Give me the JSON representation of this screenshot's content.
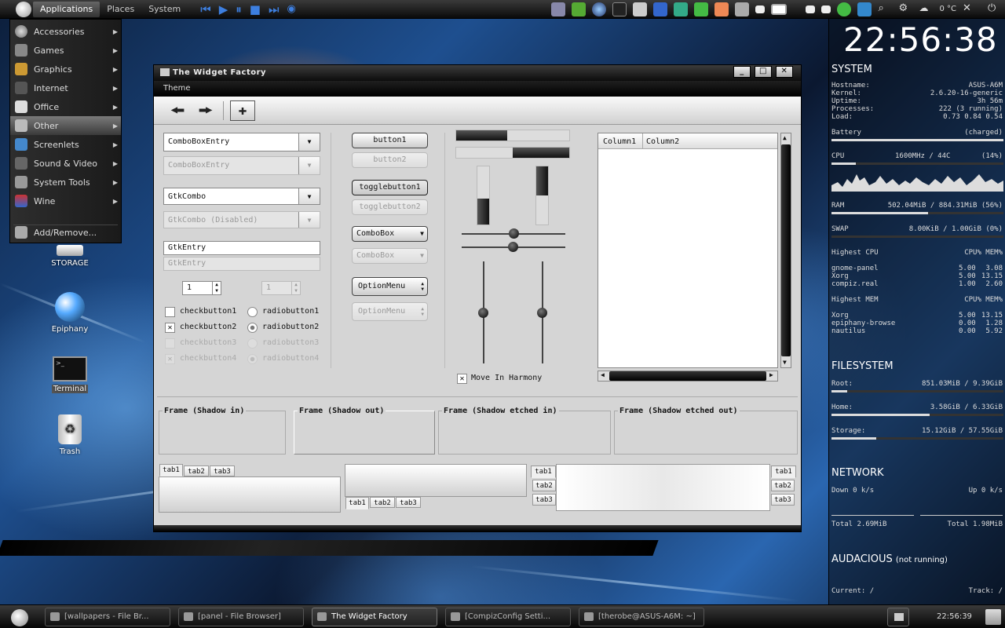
{
  "top_panel": {
    "menus": [
      "Applications",
      "Places",
      "System"
    ],
    "temperature": "0 °C"
  },
  "apps_menu": {
    "items": [
      {
        "label": "Accessories",
        "icon": "accessories-icon"
      },
      {
        "label": "Games",
        "icon": "games-icon"
      },
      {
        "label": "Graphics",
        "icon": "graphics-icon"
      },
      {
        "label": "Internet",
        "icon": "internet-icon"
      },
      {
        "label": "Office",
        "icon": "office-icon"
      },
      {
        "label": "Other",
        "icon": "other-icon"
      },
      {
        "label": "Screenlets",
        "icon": "screenlets-icon"
      },
      {
        "label": "Sound & Video",
        "icon": "sound-video-icon"
      },
      {
        "label": "System Tools",
        "icon": "system-tools-icon"
      },
      {
        "label": "Wine",
        "icon": "wine-icon"
      }
    ],
    "add_remove": "Add/Remove...",
    "selected": "Other"
  },
  "desktop_icons": [
    "STORAGE",
    "Epiphany",
    "Terminal",
    "Trash"
  ],
  "window": {
    "title": "The Widget Factory",
    "menubar": [
      "Theme"
    ],
    "combo_entry": "ComboBoxEntry",
    "combo_entry_disabled": "ComboBoxEntry",
    "gtk_combo": "GtkCombo",
    "gtk_combo_disabled": "GtkCombo (Disabled)",
    "entry": "GtkEntry",
    "entry_disabled": "GtkEntry",
    "spin1": "1",
    "spin2": "1",
    "checks": [
      "checkbutton1",
      "checkbutton2",
      "checkbutton3",
      "checkbutton4"
    ],
    "radios": [
      "radiobutton1",
      "radiobutton2",
      "radiobutton3",
      "radiobutton4"
    ],
    "buttons": [
      "button1",
      "button2"
    ],
    "toggles": [
      "togglebutton1",
      "togglebutton2"
    ],
    "combobox": "ComboBox",
    "combobox_disabled": "ComboBox",
    "optionmenu": "OptionMenu",
    "optionmenu_disabled": "OptionMenu",
    "move_in_harmony": "Move In Harmony",
    "columns": [
      "Column1",
      "Column2"
    ],
    "frames": [
      "Frame (Shadow in)",
      "Frame (Shadow out)",
      "Frame (Shadow etched in)",
      "Frame (Shadow etched out)"
    ],
    "tabs": [
      "tab1",
      "tab2",
      "tab3"
    ]
  },
  "taskbar": {
    "tasks": [
      "[wallpapers - File Br...",
      "[panel - File Browser]",
      "The Widget Factory",
      "[CompizConfig Setti...",
      "[therobe@ASUS-A6M: ~]"
    ],
    "clock": "22:56:39"
  },
  "conky": {
    "time": "22:56:38",
    "system_header": "SYSTEM",
    "system": [
      [
        "Hostname:",
        "ASUS-A6M"
      ],
      [
        "Kernel:",
        "2.6.20-16-generic"
      ],
      [
        "Uptime:",
        "3h 56m"
      ],
      [
        "Processes:",
        "222 (3 running)"
      ],
      [
        "Load:",
        "0.73 0.84 0.54"
      ]
    ],
    "battery": [
      "Battery",
      "(charged)"
    ],
    "cpu": [
      "CPU",
      "1600MHz / 44C",
      "(14%)"
    ],
    "ram": [
      "RAM",
      "502.04MiB / 884.31MiB (56%)"
    ],
    "swap": [
      "SWAP",
      "8.00KiB / 1.00GiB (0%)"
    ],
    "highest_cpu": {
      "title": "Highest CPU",
      "cols": "CPU% MEM%",
      "rows": [
        [
          "gnome-panel",
          "5.00",
          "3.08"
        ],
        [
          "Xorg",
          "5.00",
          "13.15"
        ],
        [
          "compiz.real",
          "1.00",
          "2.60"
        ]
      ]
    },
    "highest_mem": {
      "title": "Highest MEM",
      "cols": "CPU% MEM%",
      "rows": [
        [
          "Xorg",
          "5.00",
          "13.15"
        ],
        [
          "epiphany-browse",
          "0.00",
          "1.28"
        ],
        [
          "nautilus",
          "0.00",
          "5.92"
        ]
      ]
    },
    "filesystem_header": "FILESYSTEM",
    "filesystem": [
      [
        "Root:",
        "851.03MiB / 9.39GiB"
      ],
      [
        "Home:",
        "3.58GiB / 6.33GiB"
      ],
      [
        "Storage:",
        "15.12GiB / 57.55GiB"
      ]
    ],
    "network_header": "NETWORK",
    "network": {
      "down": "Down 0 k/s",
      "up": "Up 0 k/s",
      "total_down": "Total 2.69MiB",
      "total_up": "Total 1.98MiB"
    },
    "audacious_header": "AUDACIOUS",
    "audacious_status": "(not running)",
    "current": "Current: /",
    "track": "Track: /"
  },
  "progress": {
    "h1": 0.45,
    "h2": 0.5,
    "v1": 0.45,
    "v2": 0.5,
    "ram": 0.56,
    "swap": 0.0,
    "cpu": 0.14,
    "root": 0.09,
    "home": 0.57,
    "storage": 0.26,
    "battery": 1.0
  },
  "sliders": {
    "h1": 0.5,
    "h2": 0.49,
    "v1": 0.5,
    "v2": 0.5
  }
}
